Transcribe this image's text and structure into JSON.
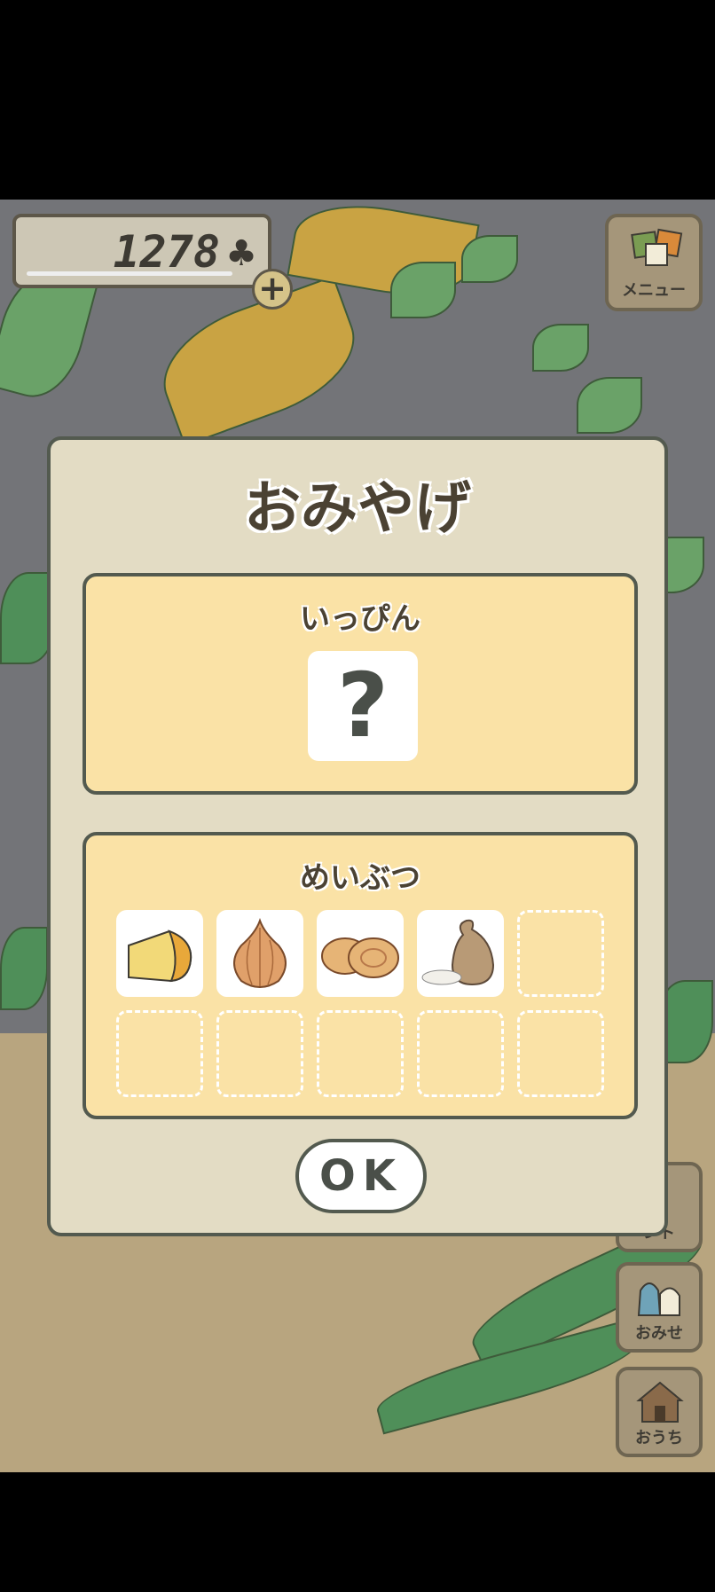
{
  "hud": {
    "coins": "1278",
    "coin_symbol": "♣",
    "plus": "+",
    "menu_label": "メニュー"
  },
  "side_buttons": [
    {
      "label": "ント",
      "icon": "ticket-icon"
    },
    {
      "label": "おみせ",
      "icon": "shop-bags-icon"
    },
    {
      "label": "おうち",
      "icon": "house-icon"
    }
  ],
  "dialog": {
    "title": "おみやげ",
    "special_section": {
      "title": "いっぴん",
      "item": "?"
    },
    "specialty_section": {
      "title": "めいぶつ",
      "items": [
        {
          "name": "cheese",
          "icon": "cheese-icon"
        },
        {
          "name": "onion",
          "icon": "onion-icon"
        },
        {
          "name": "buns",
          "icon": "buns-icon"
        },
        {
          "name": "rice-bag",
          "icon": "rice-bag-icon"
        }
      ],
      "total_slots": 10
    },
    "ok_label": "OK"
  },
  "colors": {
    "dialog_bg": "#e3dcc4",
    "panel_bg": "#fae2a6",
    "border": "#535a4f",
    "text": "#4b4233"
  }
}
